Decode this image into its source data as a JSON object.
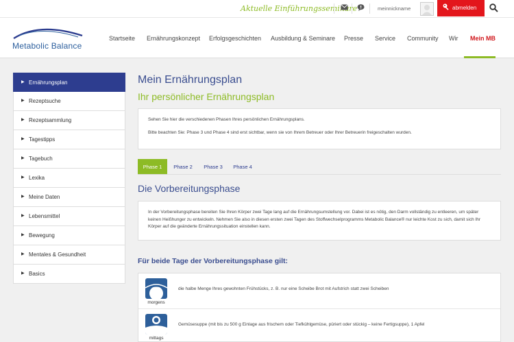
{
  "topbar": {
    "promo": "Aktuelle Einführungsseminare",
    "username": "meinnickname",
    "logout_label": "abmelden",
    "icons": [
      "mail-icon",
      "chat-icon",
      "avatar",
      "key-icon",
      "search-icon"
    ]
  },
  "logo": {
    "text": "Metabolic Balance"
  },
  "nav": {
    "items": [
      "Startseite",
      "Ernährungskonzept",
      "Erfolgsgeschichten",
      "Ausbildung & Seminare",
      "Presse",
      "Service",
      "Community",
      "Wir",
      "Mein MB"
    ],
    "active": "Mein MB"
  },
  "sidebar": {
    "items": [
      "Ernährungsplan",
      "Rezeptsuche",
      "Rezeptsammlung",
      "Tagestipps",
      "Tagebuch",
      "Lexika",
      "Meine Daten",
      "Lebensmittel",
      "Bewegung",
      "Mentales & Gesundheit",
      "Basics"
    ],
    "active": "Ernährungsplan"
  },
  "main": {
    "title": "Mein Ernährungsplan",
    "subtitle": "Ihr persönlicher Ernährungsplan",
    "info": [
      "Sehen Sie hier die verschiedenen Phasen Ihres persönlichen Ernährungsplans.",
      "Bitte beachten Sie: Phase 3 und Phase 4 sind erst sichtbar, wenn sie von Ihrem Betreuer oder Ihrer Betreuerin freigeschalten wurden."
    ],
    "tabs": [
      "Phase 1",
      "Phase 2",
      "Phase 3",
      "Phase 4"
    ],
    "active_tab": "Phase 1",
    "phase_title": "Die Vorbereitungsphase",
    "phase_text": "In der Vorbereitungsphase bereiten Sie Ihren Körper zwei Tage lang auf die Ernährungsumstellung vor. Dabei ist es nötig, den Darm vollständig zu entleeren, um später keinen Heißhunger zu entwickeln. Nehmen Sie also in diesen ersten zwei Tagen des Stoffwechselprogramms Metabolic Balance® nur leichte Kost zu sich, damit sich Ihr Körper auf die geänderte Ernährungssituation einstellen kann.",
    "days_heading": "Für beide Tage der Vorbereitungsphase gilt:",
    "days": [
      {
        "label": "morgens",
        "text": "die halbe Menge Ihres gewohnten Frühstücks, z. B. nur eine Scheibe Brot mit Aufstrich statt zwei Scheiben"
      },
      {
        "label": "mittags",
        "text": "Gemüsesuppe (mit bis zu 500 g Einlage aus frischem oder Tiefkühlgemüse, püriert oder stückig – keine Fertigsuppe), 1 Apfel"
      }
    ]
  },
  "colors": {
    "accent_green": "#8dbb25",
    "brand_blue": "#2d3d8f",
    "logout_red": "#e3161c",
    "active_nav_red": "#d0161b"
  }
}
